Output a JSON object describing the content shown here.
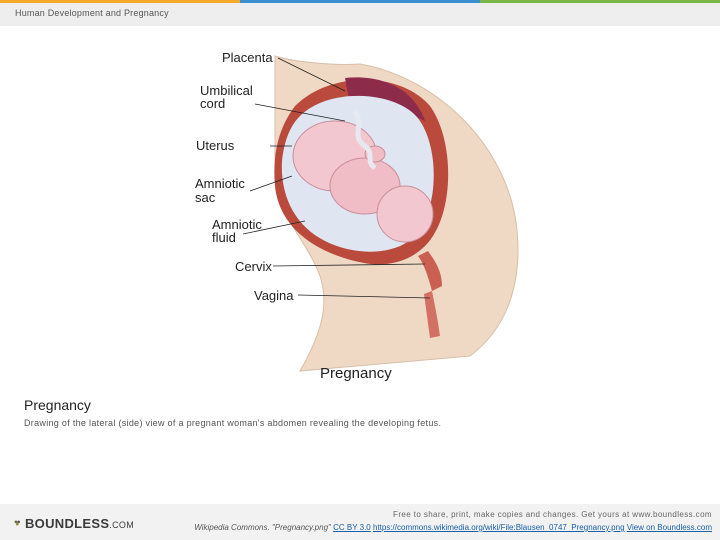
{
  "header": {
    "section_title": "Human Development and Pregnancy",
    "stripe_colors": [
      "#f4a92c",
      "#3a8fd0",
      "#7ab648"
    ]
  },
  "figure": {
    "labels": {
      "placenta": "Placenta",
      "umbilical_1": "Umbilical",
      "umbilical_2": "cord",
      "uterus": "Uterus",
      "amniotic_sac_1": "Amniotic",
      "amniotic_sac_2": "sac",
      "amniotic_fluid_1": "Amniotic",
      "amniotic_fluid_2": "fluid",
      "cervix": "Cervix",
      "vagina": "Vagina"
    },
    "title": "Pregnancy"
  },
  "caption": {
    "title": "Pregnancy",
    "text": "Drawing of the lateral (side) view of a pregnant woman's abdomen revealing the developing fetus."
  },
  "footer": {
    "logo_text": "BOUNDLESS",
    "logo_suffix": ".COM",
    "tagline": "Free to share, print, make copies and changes. Get yours at www.boundless.com",
    "source_label": "Wikipedia Commons. \"Pregnancy.png\"",
    "license_link": "CC BY 3.0",
    "url_link": "https://commons.wikimedia.org/wiki/File:Blausen_0747_Pregnancy.png",
    "view_link": "View on Boundless.com"
  },
  "colors": {
    "skin": "#efd9c4",
    "uterus_wall": "#b94a3c",
    "placenta": "#8c2b4a",
    "fetus": "#f2c7cf",
    "amniotic_fluid": "#dfe6f2",
    "link": "#1a5fa8"
  }
}
